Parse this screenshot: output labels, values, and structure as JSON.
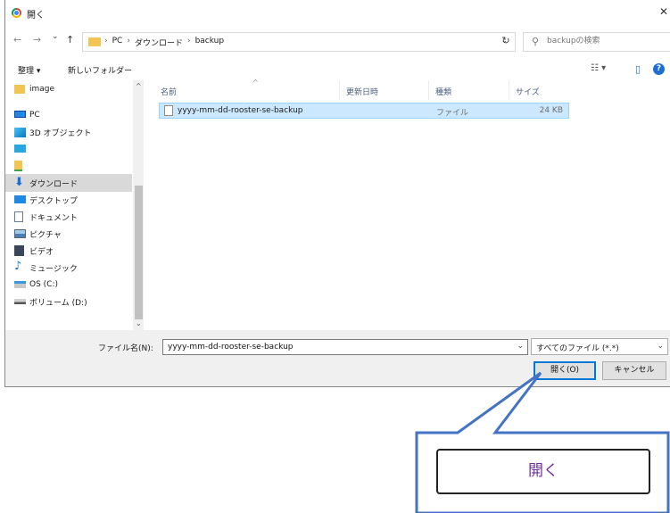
{
  "window": {
    "title": "開く",
    "close_glyph": "✕"
  },
  "nav": {
    "back": "←",
    "forward": "→",
    "recent": "⌄",
    "up": "↑",
    "breadcrumbs": [
      "PC",
      "ダウンロード",
      "backup"
    ],
    "refresh": "↻",
    "search_placeholder": "backupの検索"
  },
  "toolbar": {
    "organize": "整理 ▾",
    "new_folder": "新しいフォルダー",
    "view_glyph": "☷ ▾",
    "pane_glyph": "▯",
    "help": "?"
  },
  "sidebar": {
    "items": [
      {
        "label": "image",
        "icon": "folder-icon"
      },
      {
        "label": "PC",
        "icon": "pc-icon"
      },
      {
        "label": "3D オブジェクト",
        "icon": "3d-objects-icon"
      },
      {
        "label": "",
        "icon": "desktop-icon"
      },
      {
        "label": "",
        "icon": "user-folder-icon"
      },
      {
        "label": "ダウンロード",
        "icon": "download-icon",
        "selected": true
      },
      {
        "label": "デスクトップ",
        "icon": "desktop-icon"
      },
      {
        "label": "ドキュメント",
        "icon": "documents-icon"
      },
      {
        "label": "ピクチャ",
        "icon": "pictures-icon"
      },
      {
        "label": "ビデオ",
        "icon": "videos-icon"
      },
      {
        "label": "ミュージック",
        "icon": "music-icon"
      },
      {
        "label": "OS (C:)",
        "icon": "drive-icon"
      },
      {
        "label": "ボリューム (D:)",
        "icon": "drive-icon"
      }
    ]
  },
  "columns": {
    "name": "名前",
    "modified": "更新日時",
    "type": "種類",
    "size": "サイズ"
  },
  "files": [
    {
      "name": "yyyy-mm-dd-rooster-se-backup",
      "modified": "",
      "type": "ファイル",
      "size": "24 KB"
    }
  ],
  "footer": {
    "filename_label": "ファイル名(N):",
    "filename_value": "yyyy-mm-dd-rooster-se-backup",
    "filter_value": "すべてのファイル (*.*)",
    "open_button": "開く(O)",
    "cancel_button": "キャンセル"
  },
  "callout": {
    "text": "開く"
  },
  "colors": {
    "selection": "#cce8ff",
    "accent": "#0078d7",
    "callout_stroke": "#4472c4",
    "callout_text": "#7030a0"
  }
}
